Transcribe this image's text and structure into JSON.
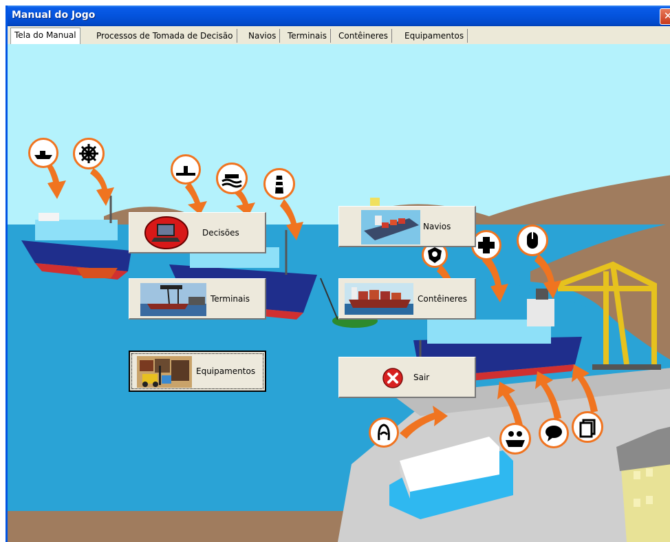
{
  "window": {
    "title": "Manual do Jogo",
    "close_glyph": "✕"
  },
  "tabs": [
    {
      "label": "Tela do Manual",
      "active": true
    },
    {
      "label": "Processos de Tomada de Decisão",
      "active": false
    },
    {
      "label": "Navios",
      "active": false
    },
    {
      "label": "Terminais",
      "active": false
    },
    {
      "label": "Contêineres",
      "active": false
    },
    {
      "label": "Equipamentos",
      "active": false
    }
  ],
  "menu_buttons": {
    "decisoes": {
      "label": "Decisões",
      "icon": "laptop-icon"
    },
    "navios": {
      "label": "Navios",
      "icon": "ship-picture-icon"
    },
    "terminais": {
      "label": "Terminais",
      "icon": "terminal-crane-picture-icon"
    },
    "conteineres": {
      "label": "Contêineres",
      "icon": "container-ship-picture-icon"
    },
    "equipamentos": {
      "label": "Equipamentos",
      "icon": "forklift-picture-icon"
    },
    "sair": {
      "label": "Sair",
      "icon": "red-x-icon"
    }
  },
  "hotspot_icons": [
    "ship-silhouette-icon",
    "ship-wheel-icon",
    "submarine-icon",
    "waves-ship-icon",
    "lighthouse-icon",
    "shield-icon",
    "medical-cross-icon",
    "mouse-icon",
    "knot-rope-icon",
    "people-boat-icon",
    "speech-bubble-icon",
    "documents-icon"
  ],
  "colors": {
    "sky": "#b4f2fc",
    "sea": "#2aa3d6",
    "land": "#a07c5e",
    "arrow": "#f07420",
    "titlebar": "#0453dd"
  }
}
